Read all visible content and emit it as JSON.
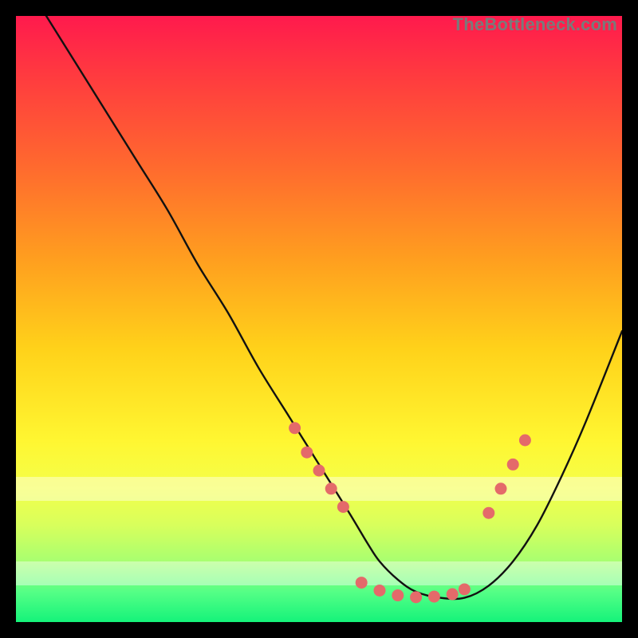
{
  "watermark": "TheBottleneck.com",
  "colors": {
    "dot": "#e46a6a",
    "curve": "#111111",
    "page_bg": "#000000"
  },
  "chart_data": {
    "type": "line",
    "title": "",
    "xlabel": "",
    "ylabel": "",
    "xlim": [
      0,
      100
    ],
    "ylim": [
      0,
      100
    ],
    "grid": false,
    "legend": false,
    "curve": {
      "name": "bottleneck-curve",
      "x": [
        0,
        5,
        10,
        15,
        20,
        25,
        30,
        35,
        40,
        45,
        50,
        55,
        58,
        60,
        63,
        66,
        70,
        74,
        78,
        82,
        86,
        90,
        94,
        100
      ],
      "y": [
        108,
        100,
        92,
        84,
        76,
        68,
        59,
        51,
        42,
        34,
        26,
        18,
        13,
        10,
        7,
        5,
        4,
        4,
        6,
        10,
        16,
        24,
        33,
        48
      ]
    },
    "series": [
      {
        "name": "dots-left-arm",
        "type": "scatter",
        "x": [
          46,
          48,
          50,
          52,
          54
        ],
        "y": [
          32,
          28,
          25,
          22,
          19
        ]
      },
      {
        "name": "dots-basin",
        "type": "scatter",
        "x": [
          57,
          60,
          63,
          66,
          69,
          72,
          74
        ],
        "y": [
          6.5,
          5.2,
          4.4,
          4.1,
          4.2,
          4.6,
          5.4
        ]
      },
      {
        "name": "dots-right-arm",
        "type": "scatter",
        "x": [
          78,
          80,
          82,
          84
        ],
        "y": [
          18,
          22,
          26,
          30
        ]
      }
    ],
    "bands": [
      {
        "name": "pale-band-upper",
        "y_from": 20,
        "y_to": 24
      },
      {
        "name": "pale-band-lower",
        "y_from": 6,
        "y_to": 10
      }
    ]
  }
}
